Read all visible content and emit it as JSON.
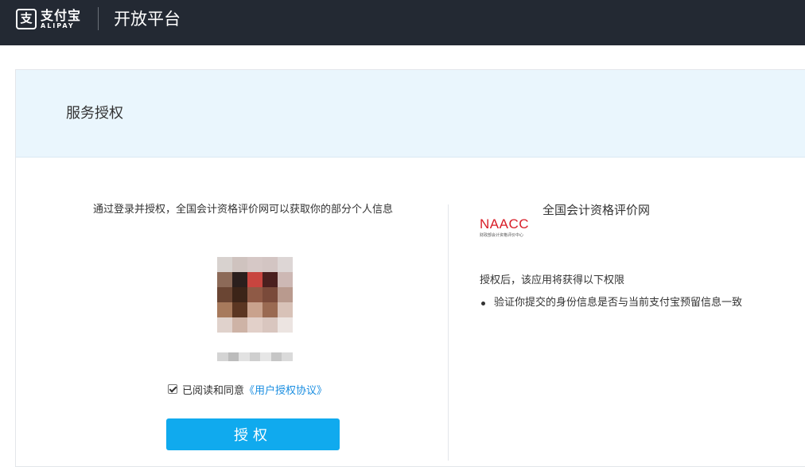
{
  "header": {
    "logo_mark": "支",
    "logo_cn": "支付宝",
    "logo_en": "ALIPAY",
    "platform_title": "开放平台"
  },
  "page": {
    "title": "服务授权"
  },
  "auth": {
    "description": "通过登录并授权，全国会计资格评价网可以获取你的部分个人信息",
    "agree_prefix": "已阅读和同意",
    "agree_link": "《用户授权协议》",
    "agree_checked": true,
    "button_label": "授权"
  },
  "app": {
    "logo_text": "NAACC",
    "logo_subtext": "财政部会计资格评价中心",
    "name": "全国会计资格评价网",
    "permission_intro": "授权后，该应用将获得以下权限",
    "permissions": [
      "验证你提交的身份信息是否与当前支付宝预留信息一致"
    ]
  },
  "colors": {
    "header_bg": "#232933",
    "card_head_bg": "#eaf6fd",
    "button_bg": "#10aaee",
    "link": "#1a8ee1",
    "app_logo_red": "#d81e28"
  },
  "icons": {
    "logo": "alipay-logo-icon",
    "avatar": "blurred-avatar-image",
    "bullet": "bullet-dot-icon",
    "checkbox": "checkbox-checked-icon"
  }
}
